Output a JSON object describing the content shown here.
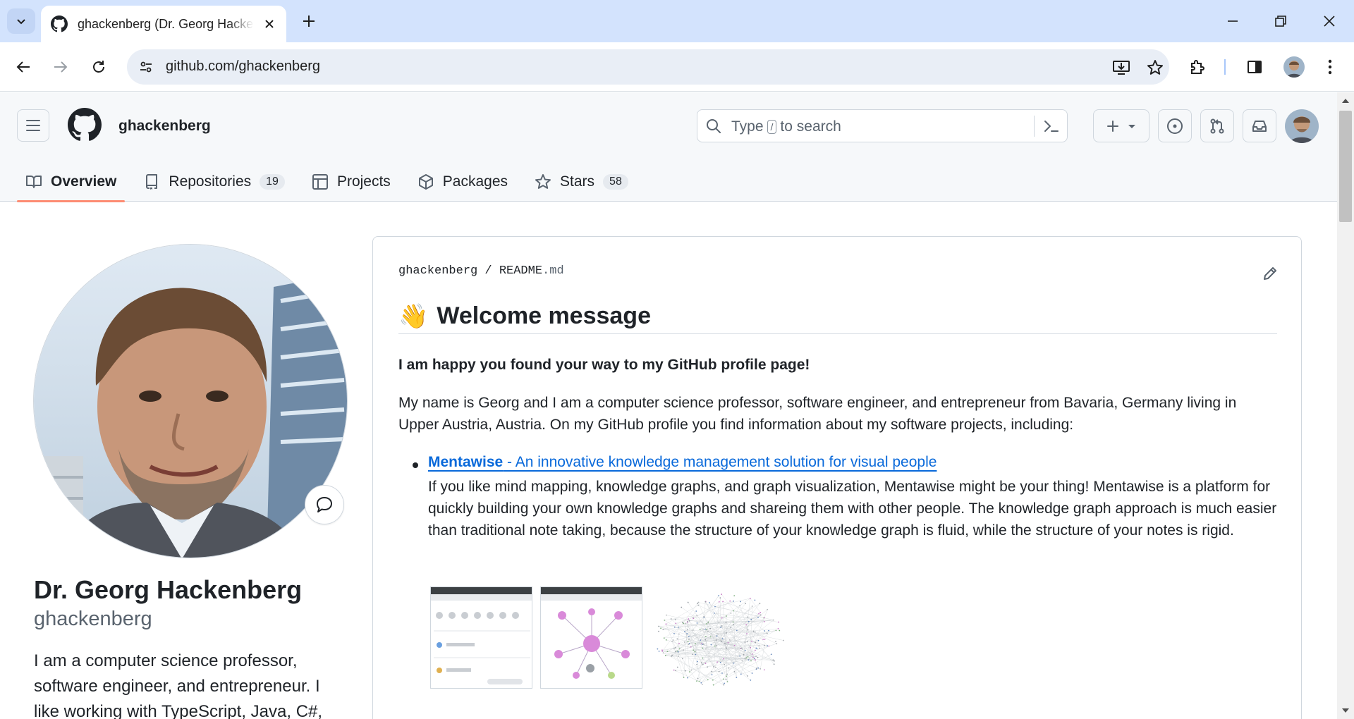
{
  "browser": {
    "tab_title": "ghackenberg (Dr. Georg Hackenberg)",
    "url": "github.com/ghackenberg"
  },
  "header": {
    "username": "ghackenberg",
    "search": {
      "prefix": "Type",
      "key": "/",
      "suffix": "to search"
    }
  },
  "nav": {
    "tabs": [
      {
        "label": "Overview",
        "icon": "book-icon",
        "selected": true
      },
      {
        "label": "Repositories",
        "icon": "repo-icon",
        "count": "19"
      },
      {
        "label": "Projects",
        "icon": "table-icon"
      },
      {
        "label": "Packages",
        "icon": "package-icon"
      },
      {
        "label": "Stars",
        "icon": "star-icon",
        "count": "58"
      }
    ]
  },
  "profile": {
    "name": "Dr. Georg Hackenberg",
    "login": "ghackenberg",
    "bio": "I am a computer science professor, software engineer, and entrepreneur. I like working with TypeScript, Java, C#,"
  },
  "readme": {
    "path_user": "ghackenberg",
    "path_sep": "/",
    "path_file": "README",
    "path_ext": ".md",
    "heading_emoji": "👋",
    "heading": "Welcome message",
    "intro_bold": "I am happy you found your way to my GitHub profile page!",
    "intro": "My name is Georg and I am a computer science professor, software engineer, and entrepreneur from Bavaria, Germany living in Upper Austria, Austria. On my GitHub profile you find information about my software projects, including:",
    "items": [
      {
        "title": "Mentawise",
        "subtitle": " - An innovative knowledge management solution for visual people",
        "description": "If you like mind mapping, knowledge graphs, and graph visualization, Mentawise might be your thing! Mentawise is a platform for quickly building your own knowledge graphs and shareing them with other people. The knowledge graph approach is much easier than traditional note taking, because the structure of your knowledge graph is fluid, while the structure of your notes is rigid."
      }
    ]
  },
  "colors": {
    "link": "#0969da",
    "tab_underline": "#fd8c73",
    "chrome_tabstrip": "#d3e3fd"
  }
}
